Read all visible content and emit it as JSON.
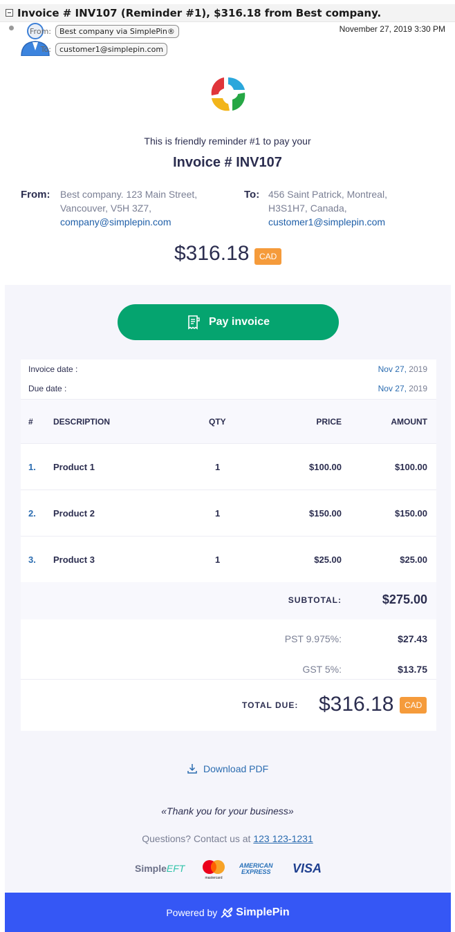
{
  "email": {
    "subject": "Invoice # INV107 (Reminder #1), $316.18 from Best company.",
    "from_label": "From:",
    "from_value": "Best company via SimplePin®",
    "to_label": "To:",
    "to_value": "customer1@simplepin.com",
    "date": "November 27, 2019 3:30 PM"
  },
  "invoice": {
    "reminder_text": "This is friendly reminder #1 to pay your",
    "title": "Invoice # INV107",
    "from_label": "From:",
    "from_lines": [
      "Best company. 123 Main Street,",
      "Vancouver, V5H 3Z7,"
    ],
    "from_email": "company@simplepin.com",
    "to_label": "To:",
    "to_lines": [
      "456 Saint Patrick, Montreal,",
      "H3S1H7, Canada,"
    ],
    "to_email": "customer1@simplepin.com",
    "amount": "$316.18",
    "currency": "CAD",
    "pay_button": "Pay invoice",
    "invoice_date_label": "Invoice date :",
    "invoice_date_md": "Nov 27,",
    "invoice_date_year": " 2019",
    "due_date_label": "Due date :",
    "due_date_md": "Nov 27,",
    "due_date_year": " 2019",
    "columns": [
      "#",
      "DESCRIPTION",
      "QTY",
      "PRICE",
      "AMOUNT"
    ],
    "items": [
      {
        "num": "1.",
        "desc": "Product 1",
        "qty": "1",
        "price": "$100.00",
        "amount": "$100.00"
      },
      {
        "num": "2.",
        "desc": "Product 2",
        "qty": "1",
        "price": "$150.00",
        "amount": "$150.00"
      },
      {
        "num": "3.",
        "desc": "Product 3",
        "qty": "1",
        "price": "$25.00",
        "amount": "$25.00"
      }
    ],
    "subtotal_label": "SUBTOTAL:",
    "subtotal": "$275.00",
    "taxes": [
      {
        "label": "PST 9.975%:",
        "value": "$27.43"
      },
      {
        "label": "GST 5%:",
        "value": "$13.75"
      }
    ],
    "total_label": "TOTAL DUE:",
    "total": "$316.18",
    "total_currency": "CAD",
    "download_label": "Download PDF",
    "thanks": "«Thank you for your business»",
    "questions_prefix": "Questions? Contact us at ",
    "phone": "123 123-1231",
    "payment_logos": {
      "simple": "Simple",
      "eft": "EFT",
      "mastercard": "mastercard",
      "amex_line1": "AMERICAN",
      "amex_line2": "EXPRESS",
      "visa": "VISA"
    },
    "powered_by": "Powered by",
    "brand": "SimplePin"
  },
  "colors": {
    "accent_green": "#05a46f",
    "badge_orange": "#f59b3b",
    "footer_blue": "#3557f5",
    "link_blue": "#2b6cb0"
  }
}
